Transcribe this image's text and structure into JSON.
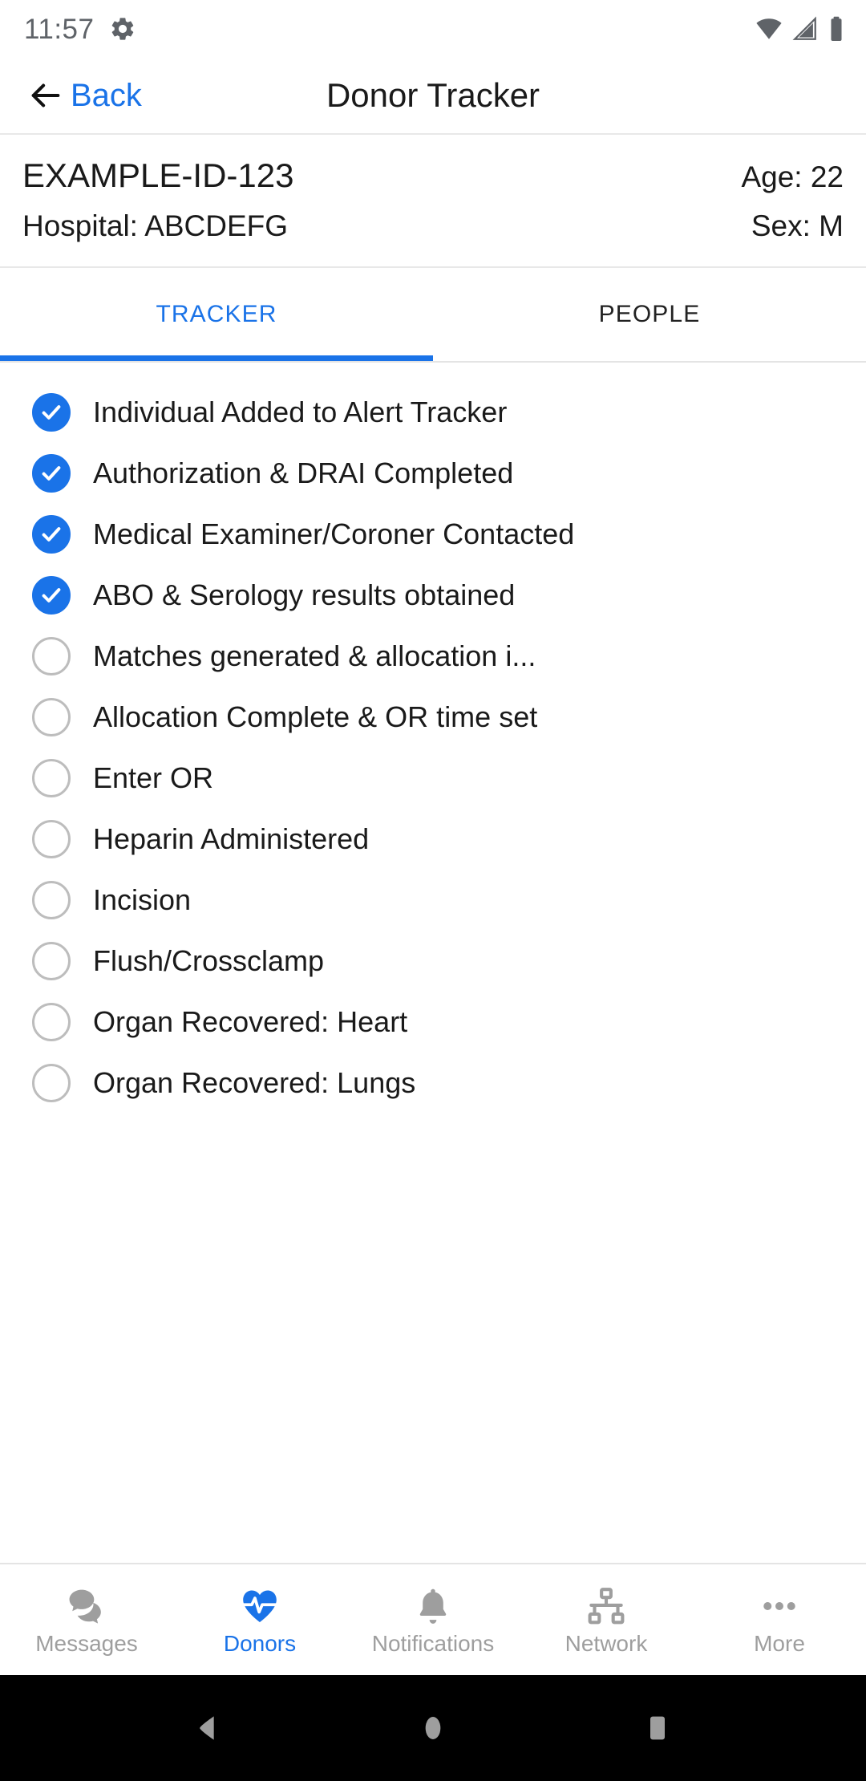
{
  "status_bar": {
    "time": "11:57",
    "left_icons": [
      "gear-icon"
    ],
    "right_icons": [
      "wifi-icon",
      "cellular-signal-icon",
      "battery-icon"
    ]
  },
  "app_bar": {
    "back_label": "Back",
    "title": "Donor Tracker"
  },
  "donor_info": {
    "id": "EXAMPLE-ID-123",
    "age": "Age: 22",
    "hospital": "Hospital: ABCDEFG",
    "sex": "Sex: M"
  },
  "tabs": [
    {
      "label": "TRACKER",
      "active": true
    },
    {
      "label": "PEOPLE",
      "active": false
    }
  ],
  "checklist": [
    {
      "label": "Individual Added to Alert Tracker",
      "checked": true
    },
    {
      "label": "Authorization & DRAI Completed",
      "checked": true
    },
    {
      "label": "Medical Examiner/Coroner Contacted",
      "checked": true
    },
    {
      "label": "ABO & Serology results obtained",
      "checked": true
    },
    {
      "label": "Matches generated & allocation i...",
      "checked": false
    },
    {
      "label": "Allocation Complete & OR time set",
      "checked": false
    },
    {
      "label": "Enter OR",
      "checked": false
    },
    {
      "label": "Heparin Administered",
      "checked": false
    },
    {
      "label": "Incision",
      "checked": false
    },
    {
      "label": "Flush/Crossclamp",
      "checked": false
    },
    {
      "label": "Organ Recovered: Heart",
      "checked": false
    },
    {
      "label": "Organ Recovered: Lungs",
      "checked": false
    }
  ],
  "bottom_nav": [
    {
      "label": "Messages",
      "icon": "chat-bubbles-icon",
      "active": false
    },
    {
      "label": "Donors",
      "icon": "heart-pulse-icon",
      "active": true
    },
    {
      "label": "Notifications",
      "icon": "bell-icon",
      "active": false
    },
    {
      "label": "Network",
      "icon": "network-hierarchy-icon",
      "active": false
    },
    {
      "label": "More",
      "icon": "three-dots-icon",
      "active": false
    }
  ],
  "system_nav": [
    {
      "name": "back-triangle-icon"
    },
    {
      "name": "home-circle-icon"
    },
    {
      "name": "recents-square-icon"
    }
  ],
  "colors": {
    "accent": "#1a73e8",
    "inactive": "#9e9e9e",
    "text": "#1a1a1a",
    "checkbox_border": "#bdbdbd"
  }
}
